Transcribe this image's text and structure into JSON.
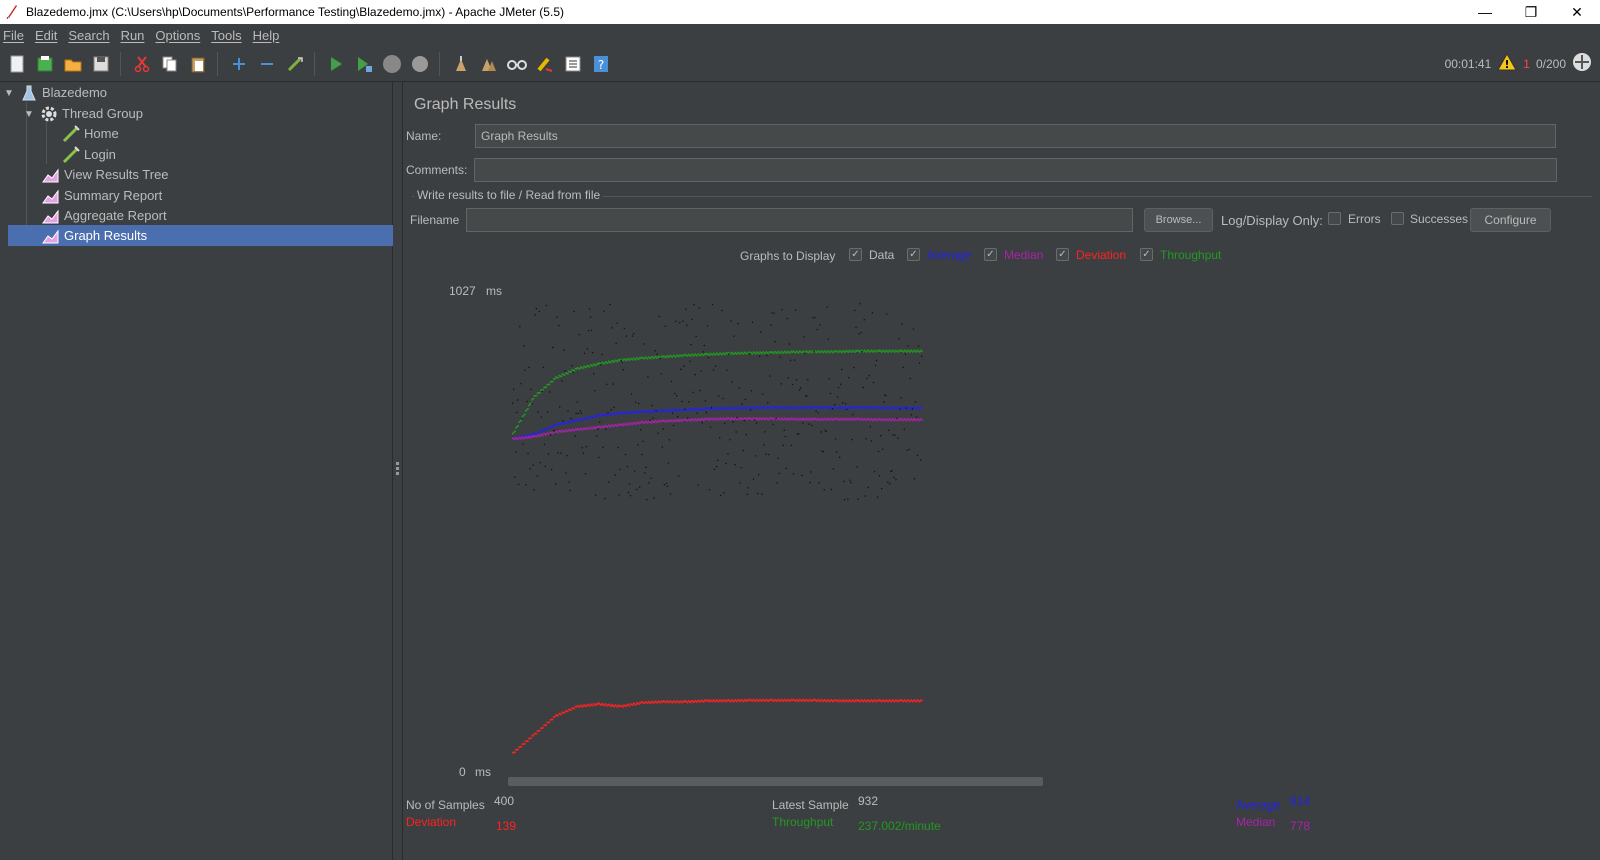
{
  "window": {
    "title": "Blazedemo.jmx (C:\\Users\\hp\\Documents\\Performance Testing\\Blazedemo.jmx) - Apache JMeter (5.5)",
    "minimize": "—",
    "maximize": "❐",
    "close": "✕"
  },
  "menu": [
    "File",
    "Edit",
    "Search",
    "Run",
    "Options",
    "Tools",
    "Help"
  ],
  "toolbar": {
    "elapsed": "00:01:41",
    "error_count": "1",
    "threads": "0/200",
    "icons": [
      "new-icon",
      "templates-icon",
      "open-icon",
      "save-icon",
      "cut-icon",
      "copy-icon",
      "paste-icon",
      "expand-icon",
      "collapse-icon",
      "toggle-icon",
      "start-icon",
      "start-no-pause-icon",
      "stop-icon",
      "shutdown-icon",
      "clear-icon",
      "clear-all-icon",
      "search-icon",
      "reset-search-icon",
      "function-helper-icon",
      "help-icon"
    ]
  },
  "tree": [
    {
      "label": "Blazedemo",
      "icon": "test-plan-icon"
    },
    {
      "label": "Thread Group",
      "icon": "gear-icon"
    },
    {
      "label": "Home",
      "icon": "sampler-icon"
    },
    {
      "label": "Login",
      "icon": "sampler-icon"
    },
    {
      "label": "View Results Tree",
      "icon": "listener-icon"
    },
    {
      "label": "Summary Report",
      "icon": "listener-icon"
    },
    {
      "label": "Aggregate Report",
      "icon": "listener-icon"
    },
    {
      "label": "Graph Results",
      "icon": "listener-icon"
    }
  ],
  "panel": {
    "title": "Graph Results",
    "name_label": "Name:",
    "name_value": "Graph Results",
    "comments_label": "Comments:",
    "comments_value": "",
    "group_title": "Write results to file / Read from file",
    "filename_label": "Filename",
    "filename_value": "",
    "browse_label": "Browse...",
    "log_display_label": "Log/Display Only:",
    "errors_label": "Errors",
    "successes_label": "Successes",
    "configure_label": "Configure",
    "graphs_label": "Graphs to Display",
    "series_toggles": [
      {
        "label": "Data",
        "color": "#bbbbbb",
        "checked": true
      },
      {
        "label": "Average",
        "color": "#2222ee",
        "checked": true
      },
      {
        "label": "Median",
        "color": "#aa22aa",
        "checked": true
      },
      {
        "label": "Deviation",
        "color": "#ff2222",
        "checked": true
      },
      {
        "label": "Throughput",
        "color": "#229922",
        "checked": true
      }
    ]
  },
  "chart_data": {
    "type": "scatter",
    "y_max_label": "1027",
    "y_min_label": "0",
    "y_unit": "ms",
    "ylim": [
      0,
      1027
    ],
    "samples": 400,
    "series": [
      {
        "name": "Average",
        "color": "#2222ee",
        "values": [
          690,
          700,
          720,
          730,
          740,
          745,
          748,
          750,
          752,
          754,
          755,
          756,
          757,
          756,
          757,
          756,
          757,
          756,
          756,
          756
        ]
      },
      {
        "name": "Median",
        "color": "#aa22aa",
        "values": [
          690,
          695,
          705,
          710,
          715,
          720,
          725,
          728,
          730,
          732,
          733,
          733,
          733,
          732,
          732,
          732,
          732,
          731,
          731,
          731
        ]
      },
      {
        "name": "Deviation",
        "color": "#ff2222",
        "values": [
          20,
          60,
          100,
          120,
          125,
          120,
          128,
          130,
          130,
          132,
          132,
          133,
          133,
          133,
          133,
          132,
          132,
          132,
          132,
          132
        ]
      },
      {
        "name": "Throughput",
        "color": "#229922",
        "values": [
          700,
          780,
          820,
          840,
          850,
          858,
          862,
          865,
          868,
          870,
          872,
          873,
          874,
          875,
          876,
          876,
          877,
          877,
          877,
          877
        ]
      }
    ]
  },
  "stats": {
    "samples_label": "No of Samples",
    "samples_value": "400",
    "latest_label": "Latest Sample",
    "latest_value": "932",
    "average_label": "Average",
    "average_value": "814",
    "deviation_label": "Deviation",
    "deviation_value": "139",
    "throughput_label": "Throughput",
    "throughput_value": "237.002/minute",
    "median_label": "Median",
    "median_value": "778"
  }
}
